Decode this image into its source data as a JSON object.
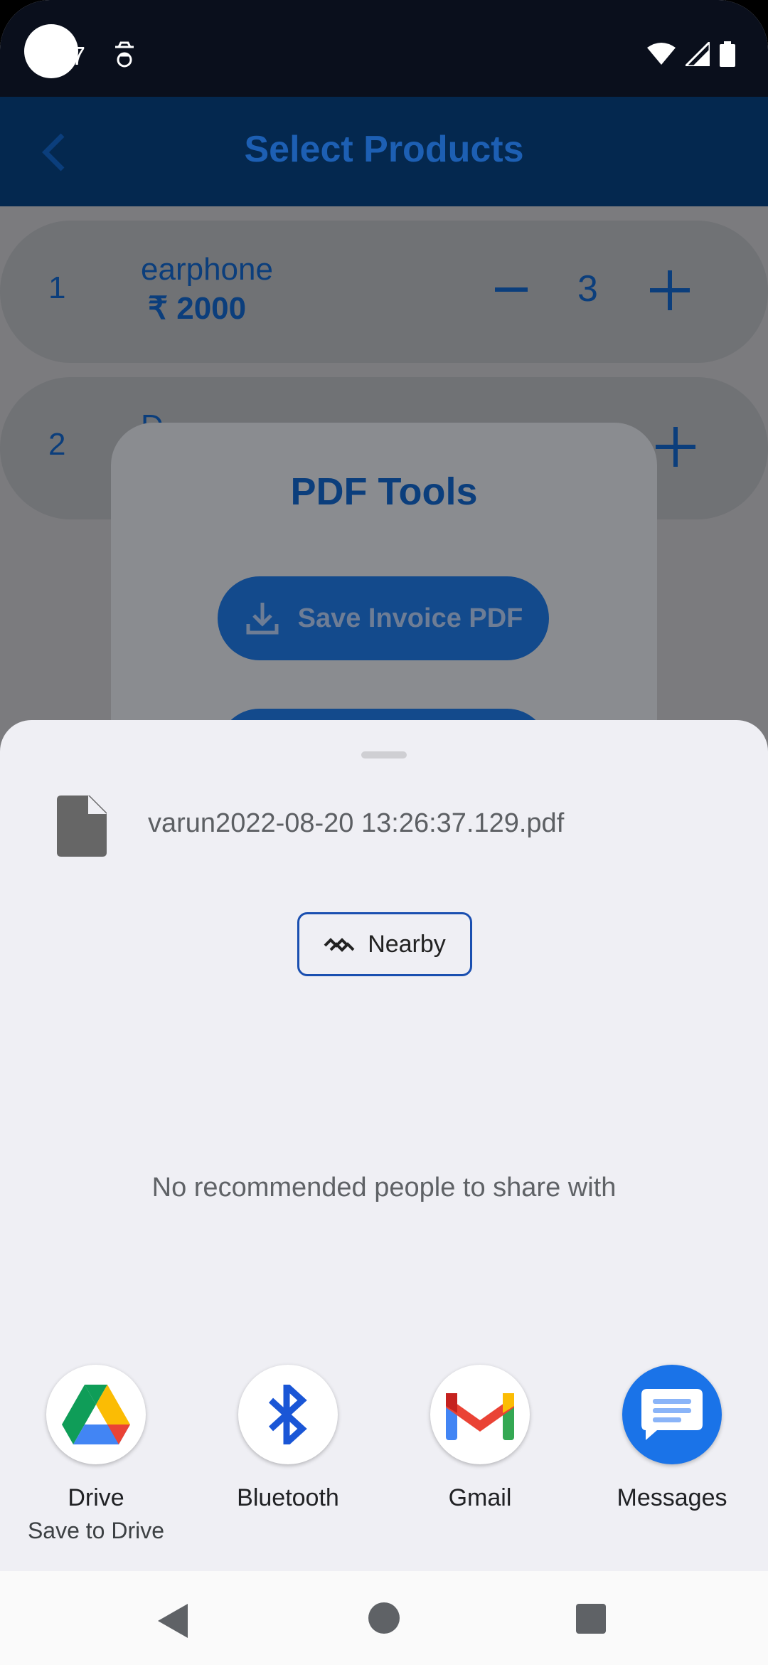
{
  "status": {
    "time": "7"
  },
  "appbar": {
    "title": "Select Products"
  },
  "products": [
    {
      "index": "1",
      "name": "earphone",
      "price": "₹ 2000",
      "qty": "3"
    },
    {
      "index": "2",
      "name": "D",
      "price": "",
      "qty": ""
    }
  ],
  "dialog": {
    "title": "PDF Tools",
    "save_label": "Save Invoice PDF"
  },
  "sheet": {
    "filename": "varun2022-08-20 13:26:37.129.pdf",
    "nearby_label": "Nearby",
    "no_recommend": "No recommended people to share with"
  },
  "apps": [
    {
      "label": "Drive",
      "sub": "Save to Drive",
      "icon": "google-drive-icon"
    },
    {
      "label": "Bluetooth",
      "sub": "",
      "icon": "bluetooth-icon"
    },
    {
      "label": "Gmail",
      "sub": "",
      "icon": "gmail-icon"
    },
    {
      "label": "Messages",
      "sub": "",
      "icon": "messages-icon"
    }
  ],
  "colors": {
    "accent": "#1a73e8",
    "appbar": "#04284f",
    "sheet_bg": "#efeff4"
  }
}
